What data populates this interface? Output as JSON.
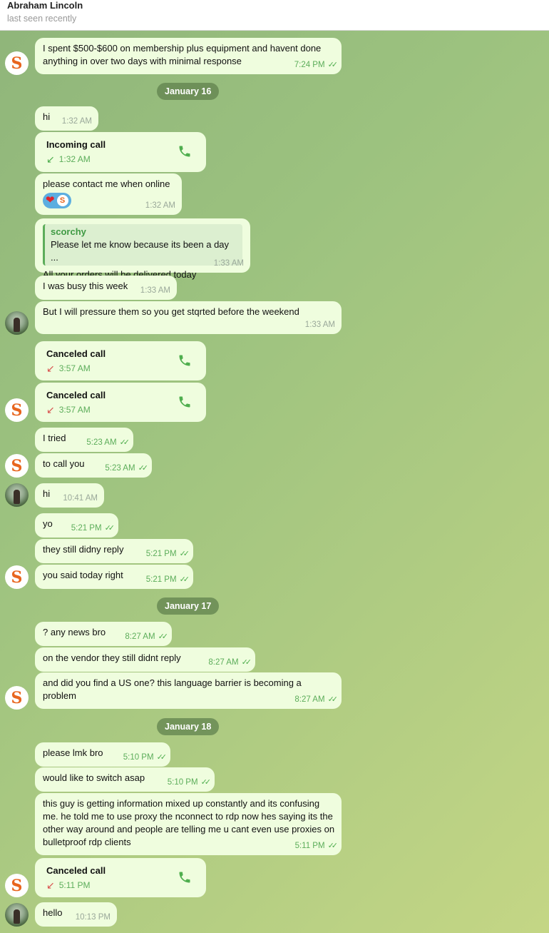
{
  "header": {
    "name": "Abraham Lincoln",
    "status": "last seen recently"
  },
  "avatars": {
    "self_letter": "S"
  },
  "dates": [
    "January 16",
    "January 17",
    "January 18"
  ],
  "messages": {
    "m0": {
      "text": "I spent $500-$600 on membership plus equipment and havent done anything in over two days with minimal response",
      "time": "7:24 PM"
    },
    "m1": {
      "text": "hi",
      "time": "1:32 AM"
    },
    "m2": {
      "title": "Incoming call",
      "time": "1:32 AM"
    },
    "m3": {
      "text": "please contact me when online",
      "time": "1:32 AM"
    },
    "m4": {
      "reply_name": "scorchy",
      "reply_text": "Please let me know because its been a day ...",
      "text": "All your orders will be delivered today",
      "time": "1:33 AM"
    },
    "m5": {
      "text": "I was busy this week",
      "time": "1:33 AM"
    },
    "m6": {
      "text": "But I will pressure them so you get stqrted before the weekend",
      "time": "1:33 AM"
    },
    "m7": {
      "title": "Canceled call",
      "time": "3:57 AM"
    },
    "m8": {
      "title": "Canceled call",
      "time": "3:57 AM"
    },
    "m9": {
      "text": "I tried",
      "time": "5:23 AM"
    },
    "m10": {
      "text": "to call you",
      "time": "5:23 AM"
    },
    "m11": {
      "text": "hi",
      "time": "10:41 AM"
    },
    "m12": {
      "text": "yo",
      "time": "5:21 PM"
    },
    "m13": {
      "text": "they still didny reply",
      "time": "5:21 PM"
    },
    "m14": {
      "text": "you said today right",
      "time": "5:21 PM"
    },
    "m15": {
      "text": "? any news bro",
      "time": "8:27 AM"
    },
    "m16": {
      "text": "on the vendor they still didnt reply",
      "time": "8:27 AM"
    },
    "m17": {
      "text": "and did you find a US one? this language barrier is becoming a problem",
      "time": "8:27 AM"
    },
    "m18": {
      "text": "please lmk bro",
      "time": "5:10 PM"
    },
    "m19": {
      "text": "would like to switch asap",
      "time": "5:10 PM"
    },
    "m20": {
      "text": "this guy is getting information mixed up constantly and its confusing me. he told me to use proxy the nconnect to rdp now hes saying its the other way around and people are telling me u cant even use proxies on bulletproof rdp clients",
      "time": "5:11 PM"
    },
    "m21": {
      "title": "Canceled call",
      "time": "5:11 PM"
    },
    "m22": {
      "text": "hello",
      "time": "10:13 PM"
    }
  },
  "colors": {
    "bubble": "#effdde",
    "accent": "#5cad5a",
    "missed": "#d9534f"
  }
}
